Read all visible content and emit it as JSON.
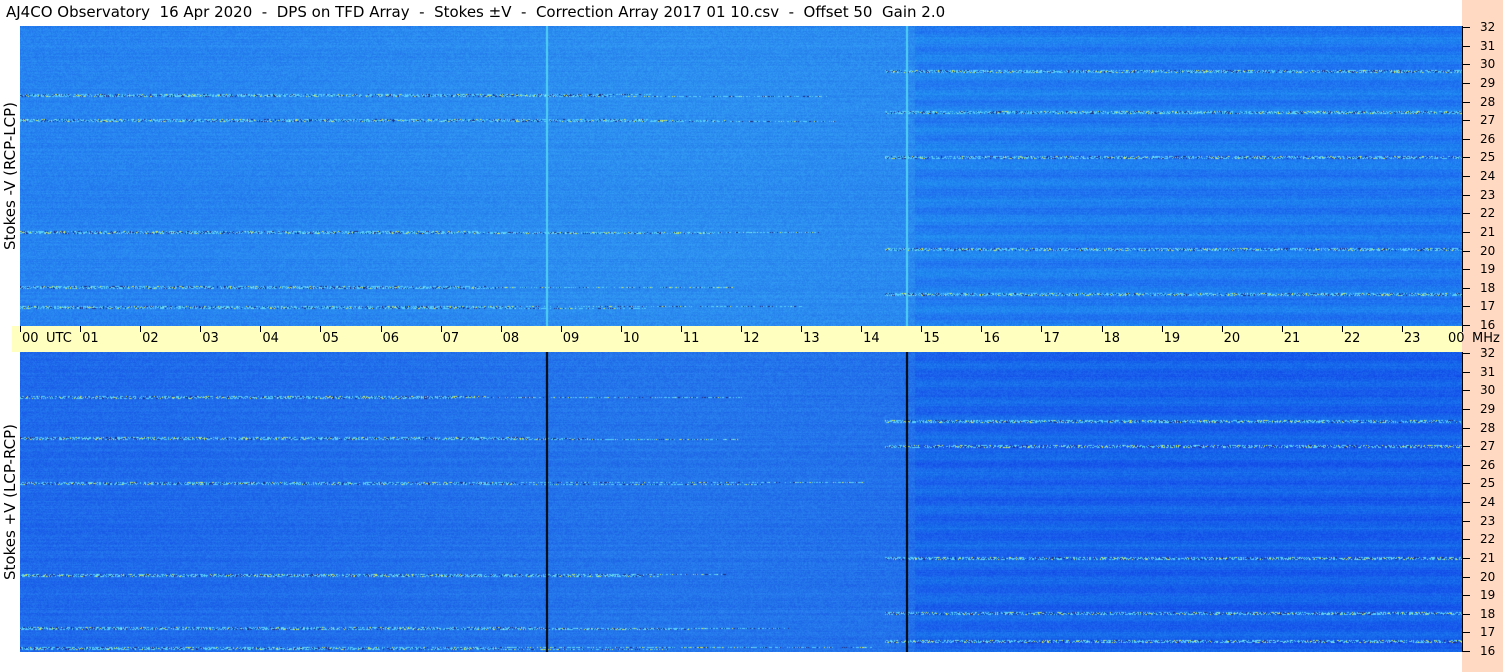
{
  "title": "AJ4CO Observatory  16 Apr 2020  -  DPS on TFD Array  -  Stokes ±V  -  Correction Array 2017 01 10.csv  -  Offset 50  Gain 2.0",
  "colors": {
    "background": "#ffffff",
    "time_bar": "#ffffc0",
    "freq_strip": "#ffd9c2",
    "spectrogram_base": "#2a7df2",
    "spectrogram_deep": "#1046d8",
    "spectrogram_light": "#39a8f5"
  },
  "chart_data": [
    {
      "type": "heatmap",
      "title": "",
      "ylabel": "Stokes -V (RCP-LCP)",
      "x_axis": {
        "ticks": [
          "00",
          "01",
          "02",
          "03",
          "04",
          "05",
          "06",
          "07",
          "08",
          "09",
          "10",
          "11",
          "12",
          "13",
          "14",
          "15",
          "16",
          "17",
          "18",
          "19",
          "20",
          "21",
          "22",
          "23",
          "00"
        ],
        "range_hours": [
          0,
          24
        ],
        "label": "UTC"
      },
      "y_axis": {
        "label": "MHz",
        "range": [
          16,
          32
        ],
        "ticks": [
          "16",
          "17",
          "18",
          "19",
          "20",
          "21",
          "22",
          "23",
          "24",
          "25",
          "26",
          "27",
          "28",
          "29",
          "30",
          "31",
          "32"
        ]
      },
      "vertical_artifacts_utc": [
        8.75,
        14.75
      ],
      "artifact_style": "bright",
      "interference_bands_mhz": [
        17.0,
        17.7,
        18.1,
        20.1,
        21.0,
        25.0,
        27.0,
        27.4,
        28.3,
        29.6
      ]
    },
    {
      "type": "heatmap",
      "title": "",
      "ylabel": "Stokes +V (LCP-RCP)",
      "x_axis": {
        "ticks": [
          "00",
          "01",
          "02",
          "03",
          "04",
          "05",
          "06",
          "07",
          "08",
          "09",
          "10",
          "11",
          "12",
          "13",
          "14",
          "15",
          "16",
          "17",
          "18",
          "19",
          "20",
          "21",
          "22",
          "23",
          "00"
        ],
        "range_hours": [
          0,
          24
        ],
        "label": "UTC"
      },
      "y_axis": {
        "label": "MHz",
        "range": [
          16,
          32
        ],
        "ticks": [
          "16",
          "17",
          "18",
          "19",
          "20",
          "21",
          "22",
          "23",
          "24",
          "25",
          "26",
          "27",
          "28",
          "29",
          "30",
          "31",
          "32"
        ]
      },
      "vertical_artifacts_utc": [
        8.75,
        14.75
      ],
      "artifact_style": "dark",
      "interference_bands_mhz": [
        16.2,
        16.6,
        17.3,
        18.1,
        20.1,
        21.0,
        25.0,
        27.0,
        27.4,
        28.3,
        29.6
      ]
    }
  ]
}
